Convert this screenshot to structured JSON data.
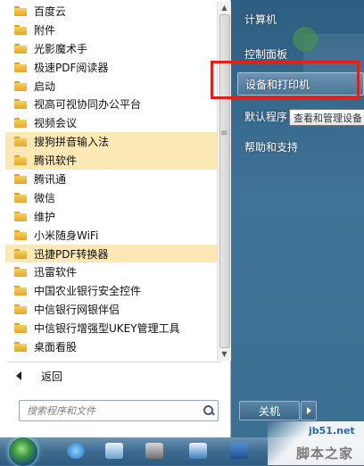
{
  "programs": [
    {
      "label": "百度云",
      "highlighted": false
    },
    {
      "label": "附件",
      "highlighted": false
    },
    {
      "label": "光影魔术手",
      "highlighted": false
    },
    {
      "label": "极速PDF阅读器",
      "highlighted": false
    },
    {
      "label": "启动",
      "highlighted": false
    },
    {
      "label": "视高可视协同办公平台",
      "highlighted": false
    },
    {
      "label": "视频会议",
      "highlighted": false
    },
    {
      "label": "搜狗拼音输入法",
      "highlighted": true
    },
    {
      "label": "腾讯软件",
      "highlighted": true
    },
    {
      "label": "腾讯通",
      "highlighted": false
    },
    {
      "label": "微信",
      "highlighted": false
    },
    {
      "label": "维护",
      "highlighted": false
    },
    {
      "label": "小米随身WiFi",
      "highlighted": false
    },
    {
      "label": "迅捷PDF转换器",
      "highlighted": true
    },
    {
      "label": "迅雷软件",
      "highlighted": false
    },
    {
      "label": "中国农业银行安全控件",
      "highlighted": false
    },
    {
      "label": "中信银行网银伴侣",
      "highlighted": false
    },
    {
      "label": "中信银行增强型UKEY管理工具",
      "highlighted": false
    },
    {
      "label": "桌面看股",
      "highlighted": false
    }
  ],
  "back_label": "返回",
  "search": {
    "placeholder": "搜索程序和文件"
  },
  "right_menu": {
    "computer": "计算机",
    "control_panel": "控制面板",
    "devices_printers": "设备和打印机",
    "default_programs": "默认程序",
    "help_support": "帮助和支持"
  },
  "tooltip": "查看和管理设备",
  "shutdown_label": "关机",
  "watermark": {
    "site": "jb51.net",
    "brand": "脚本之家"
  },
  "colors": {
    "highlight": "#fbe8b5",
    "annotation_box": "#e0201a"
  }
}
